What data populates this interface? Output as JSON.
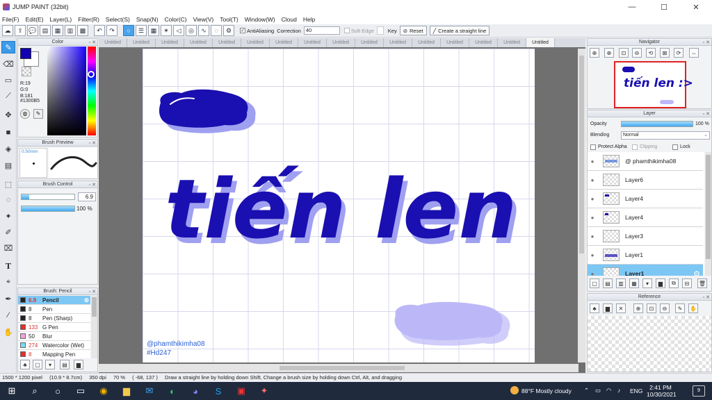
{
  "window": {
    "title": "JUMP PAINT (32bit)",
    "minimize": "—",
    "maximize": "☐",
    "close": "✕"
  },
  "menu": [
    "File(F)",
    "Edit(E)",
    "Layer(L)",
    "Filter(R)",
    "Select(S)",
    "Snap(N)",
    "Color(C)",
    "View(V)",
    "Tool(T)",
    "Window(W)",
    "Cloud",
    "Help"
  ],
  "toolbar": {
    "antialiasing_label": "AntiAliasing",
    "correction_label": "Correction",
    "correction_value": "40",
    "soft_edge_label": "Soft Edge",
    "key_label": "Key",
    "reset_label": "Reset",
    "straight_line_label": "Create a straight line"
  },
  "color_panel": {
    "title": "Color",
    "r": "R:19",
    "g": "G:0",
    "b": "B:181",
    "hex": "#1300B5",
    "foreground": "#1300B5",
    "background": "#ffffff"
  },
  "brush_preview": {
    "title": "Brush Preview",
    "size": "0.50mm"
  },
  "brush_control": {
    "title": "Brush Control",
    "size_value": "6.9",
    "opacity_value": "100 %",
    "size_fraction": 0.14,
    "opacity_fraction": 1.0
  },
  "brush_list": {
    "title": "Brush: Pencil",
    "items": [
      {
        "size": "6.9",
        "name": "Pencil",
        "color": "#222222",
        "selected": true
      },
      {
        "size": "8",
        "name": "Pen",
        "color": "#222222",
        "selected": false
      },
      {
        "size": "8",
        "name": "Pen (Sharp)",
        "color": "#222222",
        "selected": false
      },
      {
        "size": "133",
        "name": "G Pen",
        "color": "#e03030",
        "selected": false
      },
      {
        "size": "50",
        "name": "Blur",
        "color": "#f4a3d8",
        "selected": false
      },
      {
        "size": "274",
        "name": "Watercolor (Wet)",
        "color": "#7fd6f2",
        "selected": false
      },
      {
        "size": "8",
        "name": "Mapping Pen",
        "color": "#e03030",
        "selected": false
      }
    ]
  },
  "doc_tabs": [
    "Untitled",
    "Untitled",
    "Untitled",
    "Untitled",
    "Untitled",
    "Untitled",
    "Untitled",
    "Untitled",
    "Untitled",
    "Untitled",
    "Untitled",
    "Untitled",
    "Untitled",
    "Untitled",
    "Untitled",
    "Untitled"
  ],
  "artwork": {
    "main_text": "tiến len :>",
    "watermark_handle": "@phamthikimha08",
    "watermark_tag": "#Hd247",
    "ink_color": "#1a0fb0",
    "shadow_color": "#9fa0f0",
    "blob_light": "#bcb8f8"
  },
  "navigator": {
    "title": "Navigator",
    "preview_text": "tiến len :>"
  },
  "layer_panel": {
    "title": "Layer",
    "opacity_label": "Opacity",
    "opacity_value": "100 %",
    "opacity_fraction": 1.0,
    "blending_label": "Blending",
    "blending_value": "Normal",
    "protect_alpha_label": "Protect Alpha",
    "clipping_label": "Clipping",
    "lock_label": "Lock",
    "layers": [
      {
        "name": "@ phamthikimha08",
        "selected": false
      },
      {
        "name": "Layer6",
        "selected": false
      },
      {
        "name": "Layer4",
        "selected": false
      },
      {
        "name": "Layer4",
        "selected": false
      },
      {
        "name": "Layer3",
        "selected": false
      },
      {
        "name": "Layer1",
        "selected": false
      },
      {
        "name": "Layer1",
        "selected": true
      }
    ]
  },
  "reference": {
    "title": "Reference"
  },
  "status": {
    "pixel_size": "1500 * 1200 pixel",
    "physical_size": "(10.9 * 8.7cm)",
    "dpi": "350 dpi",
    "zoom": "70 %",
    "cursor": "( -68, 137 )",
    "hint": "Draw a straight line by holding down Shift, Change a brush size by holding down Ctrl, Alt, and dragging"
  },
  "taskbar": {
    "weather": "88°F  Mostly cloudy",
    "language": "ENG",
    "time": "2:41 PM",
    "date": "10/30/2021",
    "notification_count": "9"
  }
}
